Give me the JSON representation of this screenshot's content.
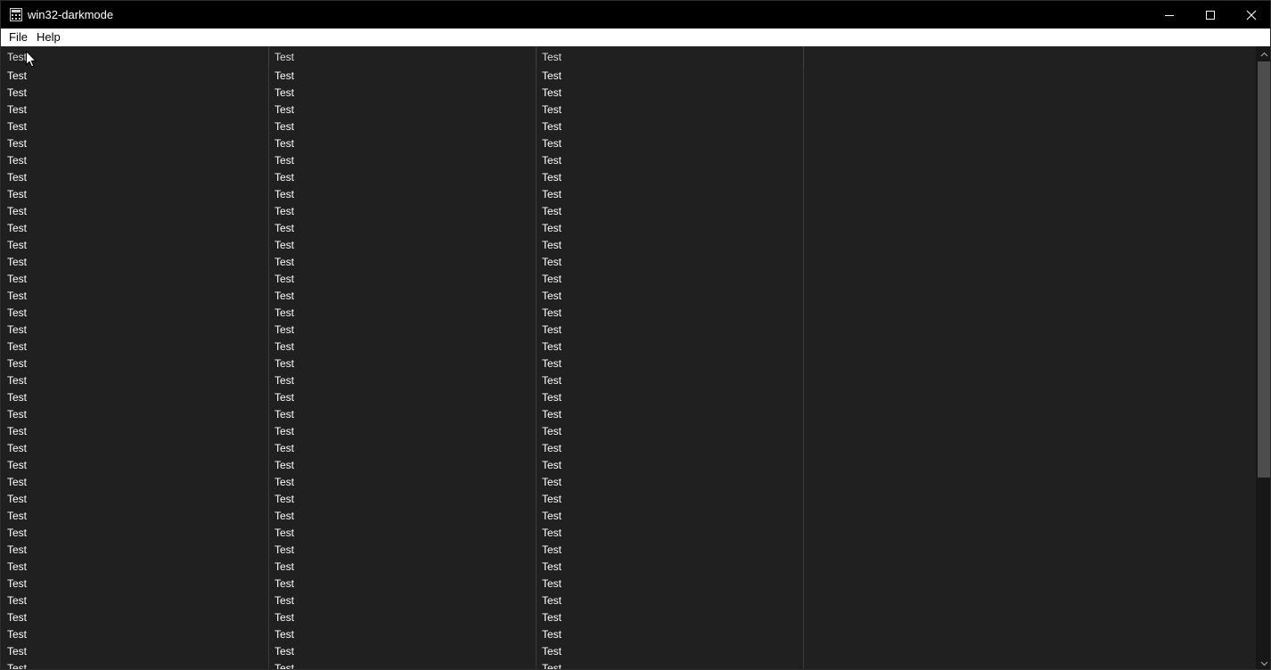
{
  "window": {
    "title": "win32-darkmode",
    "app_icon": "calculator-like-app-icon",
    "controls": [
      "minimize-icon",
      "maximize-icon",
      "close-icon"
    ]
  },
  "menu": {
    "items": [
      {
        "label": "File"
      },
      {
        "label": "Help"
      }
    ]
  },
  "list": {
    "columns": [
      "Test",
      "Test",
      "Test"
    ],
    "rows": [
      [
        "Test",
        "Test",
        "Test"
      ],
      [
        "Test",
        "Test",
        "Test"
      ],
      [
        "Test",
        "Test",
        "Test"
      ],
      [
        "Test",
        "Test",
        "Test"
      ],
      [
        "Test",
        "Test",
        "Test"
      ],
      [
        "Test",
        "Test",
        "Test"
      ],
      [
        "Test",
        "Test",
        "Test"
      ],
      [
        "Test",
        "Test",
        "Test"
      ],
      [
        "Test",
        "Test",
        "Test"
      ],
      [
        "Test",
        "Test",
        "Test"
      ],
      [
        "Test",
        "Test",
        "Test"
      ],
      [
        "Test",
        "Test",
        "Test"
      ],
      [
        "Test",
        "Test",
        "Test"
      ],
      [
        "Test",
        "Test",
        "Test"
      ],
      [
        "Test",
        "Test",
        "Test"
      ],
      [
        "Test",
        "Test",
        "Test"
      ],
      [
        "Test",
        "Test",
        "Test"
      ],
      [
        "Test",
        "Test",
        "Test"
      ],
      [
        "Test",
        "Test",
        "Test"
      ],
      [
        "Test",
        "Test",
        "Test"
      ],
      [
        "Test",
        "Test",
        "Test"
      ],
      [
        "Test",
        "Test",
        "Test"
      ],
      [
        "Test",
        "Test",
        "Test"
      ],
      [
        "Test",
        "Test",
        "Test"
      ],
      [
        "Test",
        "Test",
        "Test"
      ],
      [
        "Test",
        "Test",
        "Test"
      ],
      [
        "Test",
        "Test",
        "Test"
      ],
      [
        "Test",
        "Test",
        "Test"
      ],
      [
        "Test",
        "Test",
        "Test"
      ],
      [
        "Test",
        "Test",
        "Test"
      ],
      [
        "Test",
        "Test",
        "Test"
      ],
      [
        "Test",
        "Test",
        "Test"
      ],
      [
        "Test",
        "Test",
        "Test"
      ],
      [
        "Test",
        "Test",
        "Test"
      ],
      [
        "Test",
        "Test",
        "Test"
      ],
      [
        "Test",
        "Test",
        "Test"
      ]
    ]
  },
  "scrollbar": {
    "position_fraction": 0.0,
    "visible_fraction": 0.7
  },
  "colors": {
    "titlebar_bg": "#000000",
    "list_bg": "#202020",
    "text": "#ffffff",
    "menubar_bg": "#ffffff",
    "menubar_text": "#000000"
  }
}
